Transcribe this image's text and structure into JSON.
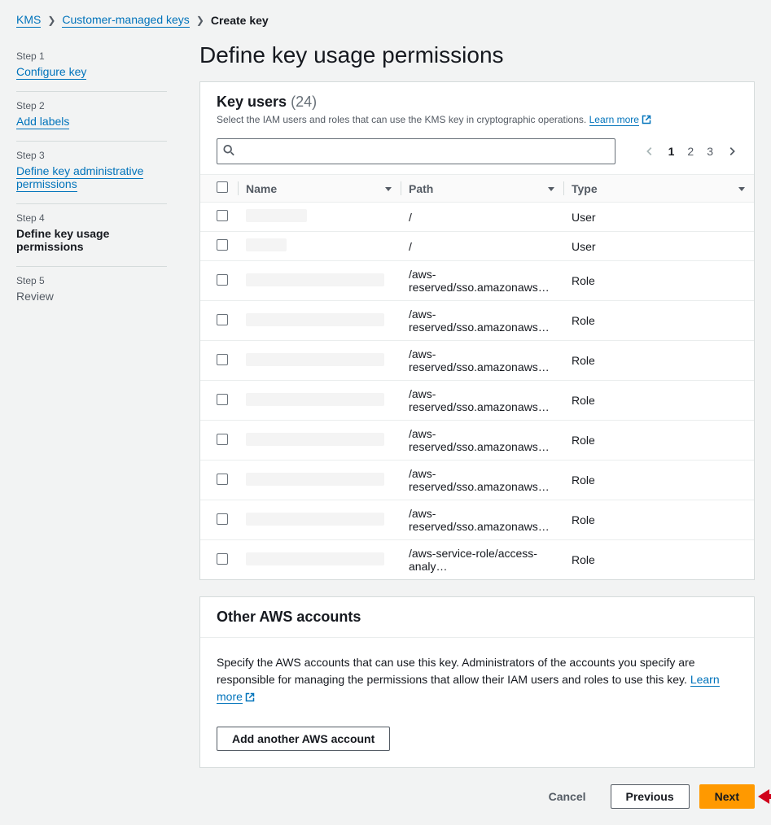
{
  "breadcrumb": {
    "root": "KMS",
    "mid": "Customer-managed keys",
    "current": "Create key"
  },
  "steps": [
    {
      "label": "Step 1",
      "title": "Configure key",
      "link": true
    },
    {
      "label": "Step 2",
      "title": "Add labels",
      "link": true
    },
    {
      "label": "Step 3",
      "title": "Define key administrative permissions",
      "link": true
    },
    {
      "label": "Step 4",
      "title": "Define key usage permissions",
      "active": true
    },
    {
      "label": "Step 5",
      "title": "Review",
      "disabled": true
    }
  ],
  "heading": "Define key usage permissions",
  "keyUsers": {
    "title": "Key users",
    "count": "(24)",
    "desc": "Select the IAM users and roles that can use the KMS key in cryptographic operations.",
    "learnMore": "Learn more",
    "searchPlaceholder": "",
    "pages": [
      "1",
      "2",
      "3"
    ],
    "columns": {
      "name": "Name",
      "path": "Path",
      "type": "Type"
    },
    "rows": [
      {
        "redactedWidth": 75,
        "path": "/",
        "type": "User"
      },
      {
        "redactedWidth": 50,
        "path": "/",
        "type": "User"
      },
      {
        "redactedWidth": 170,
        "path": "/aws-reserved/sso.amazonaws…",
        "type": "Role"
      },
      {
        "redactedWidth": 170,
        "path": "/aws-reserved/sso.amazonaws…",
        "type": "Role"
      },
      {
        "redactedWidth": 170,
        "path": "/aws-reserved/sso.amazonaws…",
        "type": "Role"
      },
      {
        "redactedWidth": 170,
        "path": "/aws-reserved/sso.amazonaws…",
        "type": "Role"
      },
      {
        "redactedWidth": 170,
        "path": "/aws-reserved/sso.amazonaws…",
        "type": "Role"
      },
      {
        "redactedWidth": 170,
        "path": "/aws-reserved/sso.amazonaws…",
        "type": "Role"
      },
      {
        "redactedWidth": 170,
        "path": "/aws-reserved/sso.amazonaws…",
        "type": "Role"
      },
      {
        "redactedWidth": 170,
        "path": "/aws-service-role/access-analy…",
        "type": "Role"
      }
    ]
  },
  "otherAccounts": {
    "title": "Other AWS accounts",
    "desc": "Specify the AWS accounts that can use this key. Administrators of the accounts you specify are responsible for managing the permissions that allow their IAM users and roles to use this key.",
    "learnMore": "Learn more",
    "addButton": "Add another AWS account"
  },
  "footer": {
    "cancel": "Cancel",
    "previous": "Previous",
    "next": "Next"
  }
}
